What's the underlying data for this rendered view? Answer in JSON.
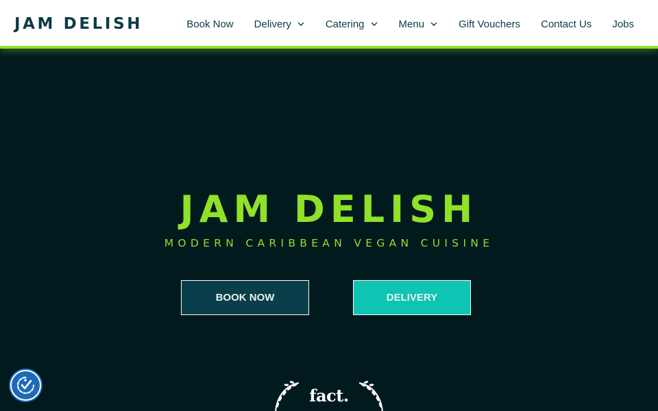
{
  "brand": {
    "name": "JAM DELISH",
    "color": "#0c3b44",
    "accent": "#8fe12a"
  },
  "nav": {
    "items": [
      {
        "label": "Book Now",
        "has_dropdown": false
      },
      {
        "label": "Delivery",
        "has_dropdown": true
      },
      {
        "label": "Catering",
        "has_dropdown": true
      },
      {
        "label": "Menu",
        "has_dropdown": true
      },
      {
        "label": "Gift Vouchers",
        "has_dropdown": false
      },
      {
        "label": "Contact Us",
        "has_dropdown": false
      },
      {
        "label": "Jobs",
        "has_dropdown": false
      }
    ]
  },
  "hero": {
    "title": "JAM DELISH",
    "subtitle": "MODERN CARIBBEAN VEGAN CUISINE",
    "background": "#011a1e",
    "book_button": {
      "label": "BOOK NOW",
      "color": "#0a3e4a"
    },
    "delivery_button": {
      "label": "DELIVERY",
      "color": "#0fc4b3"
    }
  },
  "award": {
    "text": "fact.",
    "icon": "laurel-wreath-icon"
  },
  "accessibility": {
    "icon": "accessibility-icon",
    "color": "#1e6ab8"
  }
}
